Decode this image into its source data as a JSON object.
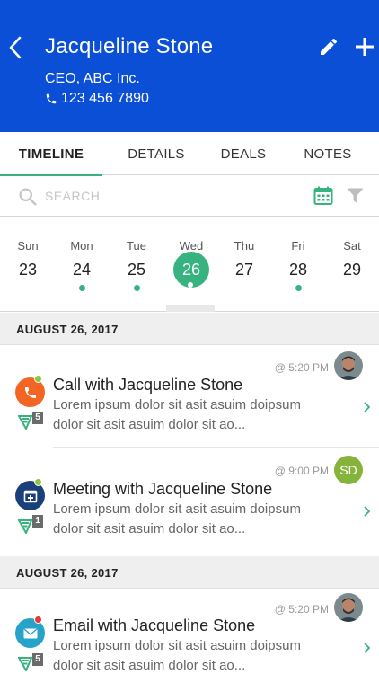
{
  "header": {
    "title": "Jacqueline Stone",
    "subtitle": "CEO, ABC Inc.",
    "phone": "123 456 7890",
    "back_icon": "chevron-left-icon",
    "edit_icon": "pencil-icon",
    "add_icon": "plus-icon"
  },
  "tabs": [
    {
      "label": "TIMELINE",
      "active": true
    },
    {
      "label": "DETAILS"
    },
    {
      "label": "DEALS"
    },
    {
      "label": "NOTES"
    }
  ],
  "search": {
    "placeholder": "SEARCH",
    "value": ""
  },
  "week": [
    {
      "name": "Sun",
      "date": "23",
      "has_events": false
    },
    {
      "name": "Mon",
      "date": "24",
      "has_events": true
    },
    {
      "name": "Tue",
      "date": "25",
      "has_events": true
    },
    {
      "name": "Wed",
      "date": "26",
      "has_events": true,
      "selected": true
    },
    {
      "name": "Thu",
      "date": "27",
      "has_events": false
    },
    {
      "name": "Fri",
      "date": "28",
      "has_events": true
    },
    {
      "name": "Sat",
      "date": "29",
      "has_events": false
    }
  ],
  "sections": [
    {
      "date": "AUGUST 26, 2017",
      "activities": [
        {
          "type": "call",
          "title": "Call with Jacqueline Stone",
          "description": "Lorem ipsum dolor sit asit asuim doipsum dolor sit asit asuim dolor sit ao...",
          "time": "@ 5:20 PM",
          "count": "5",
          "icon_color": "#f26522",
          "status_color": "#8dc63f"
        },
        {
          "type": "meeting",
          "title": "Meeting with Jacqueline Stone",
          "description": "Lorem ipsum dolor sit asit asuim doipsum dolor sit asit asuim dolor sit ao...",
          "time": "@ 9:00 PM",
          "count": "1",
          "avatar_initials": "SD",
          "icon_color": "#1b3f7a",
          "status_color": "#8dc63f"
        }
      ]
    },
    {
      "date": "AUGUST 26, 2017",
      "activities": [
        {
          "type": "email",
          "title": "Email with Jacqueline Stone",
          "description": "Lorem ipsum dolor sit asit asuim doipsum dolor sit asit asuim dolor sit ao...",
          "time": "@ 5:20 PM",
          "count": "5",
          "icon_color": "#27a3c9",
          "status_color": "#e53935"
        }
      ]
    }
  ],
  "colors": {
    "header": "#0a4fd6",
    "accent": "#36b37e"
  }
}
